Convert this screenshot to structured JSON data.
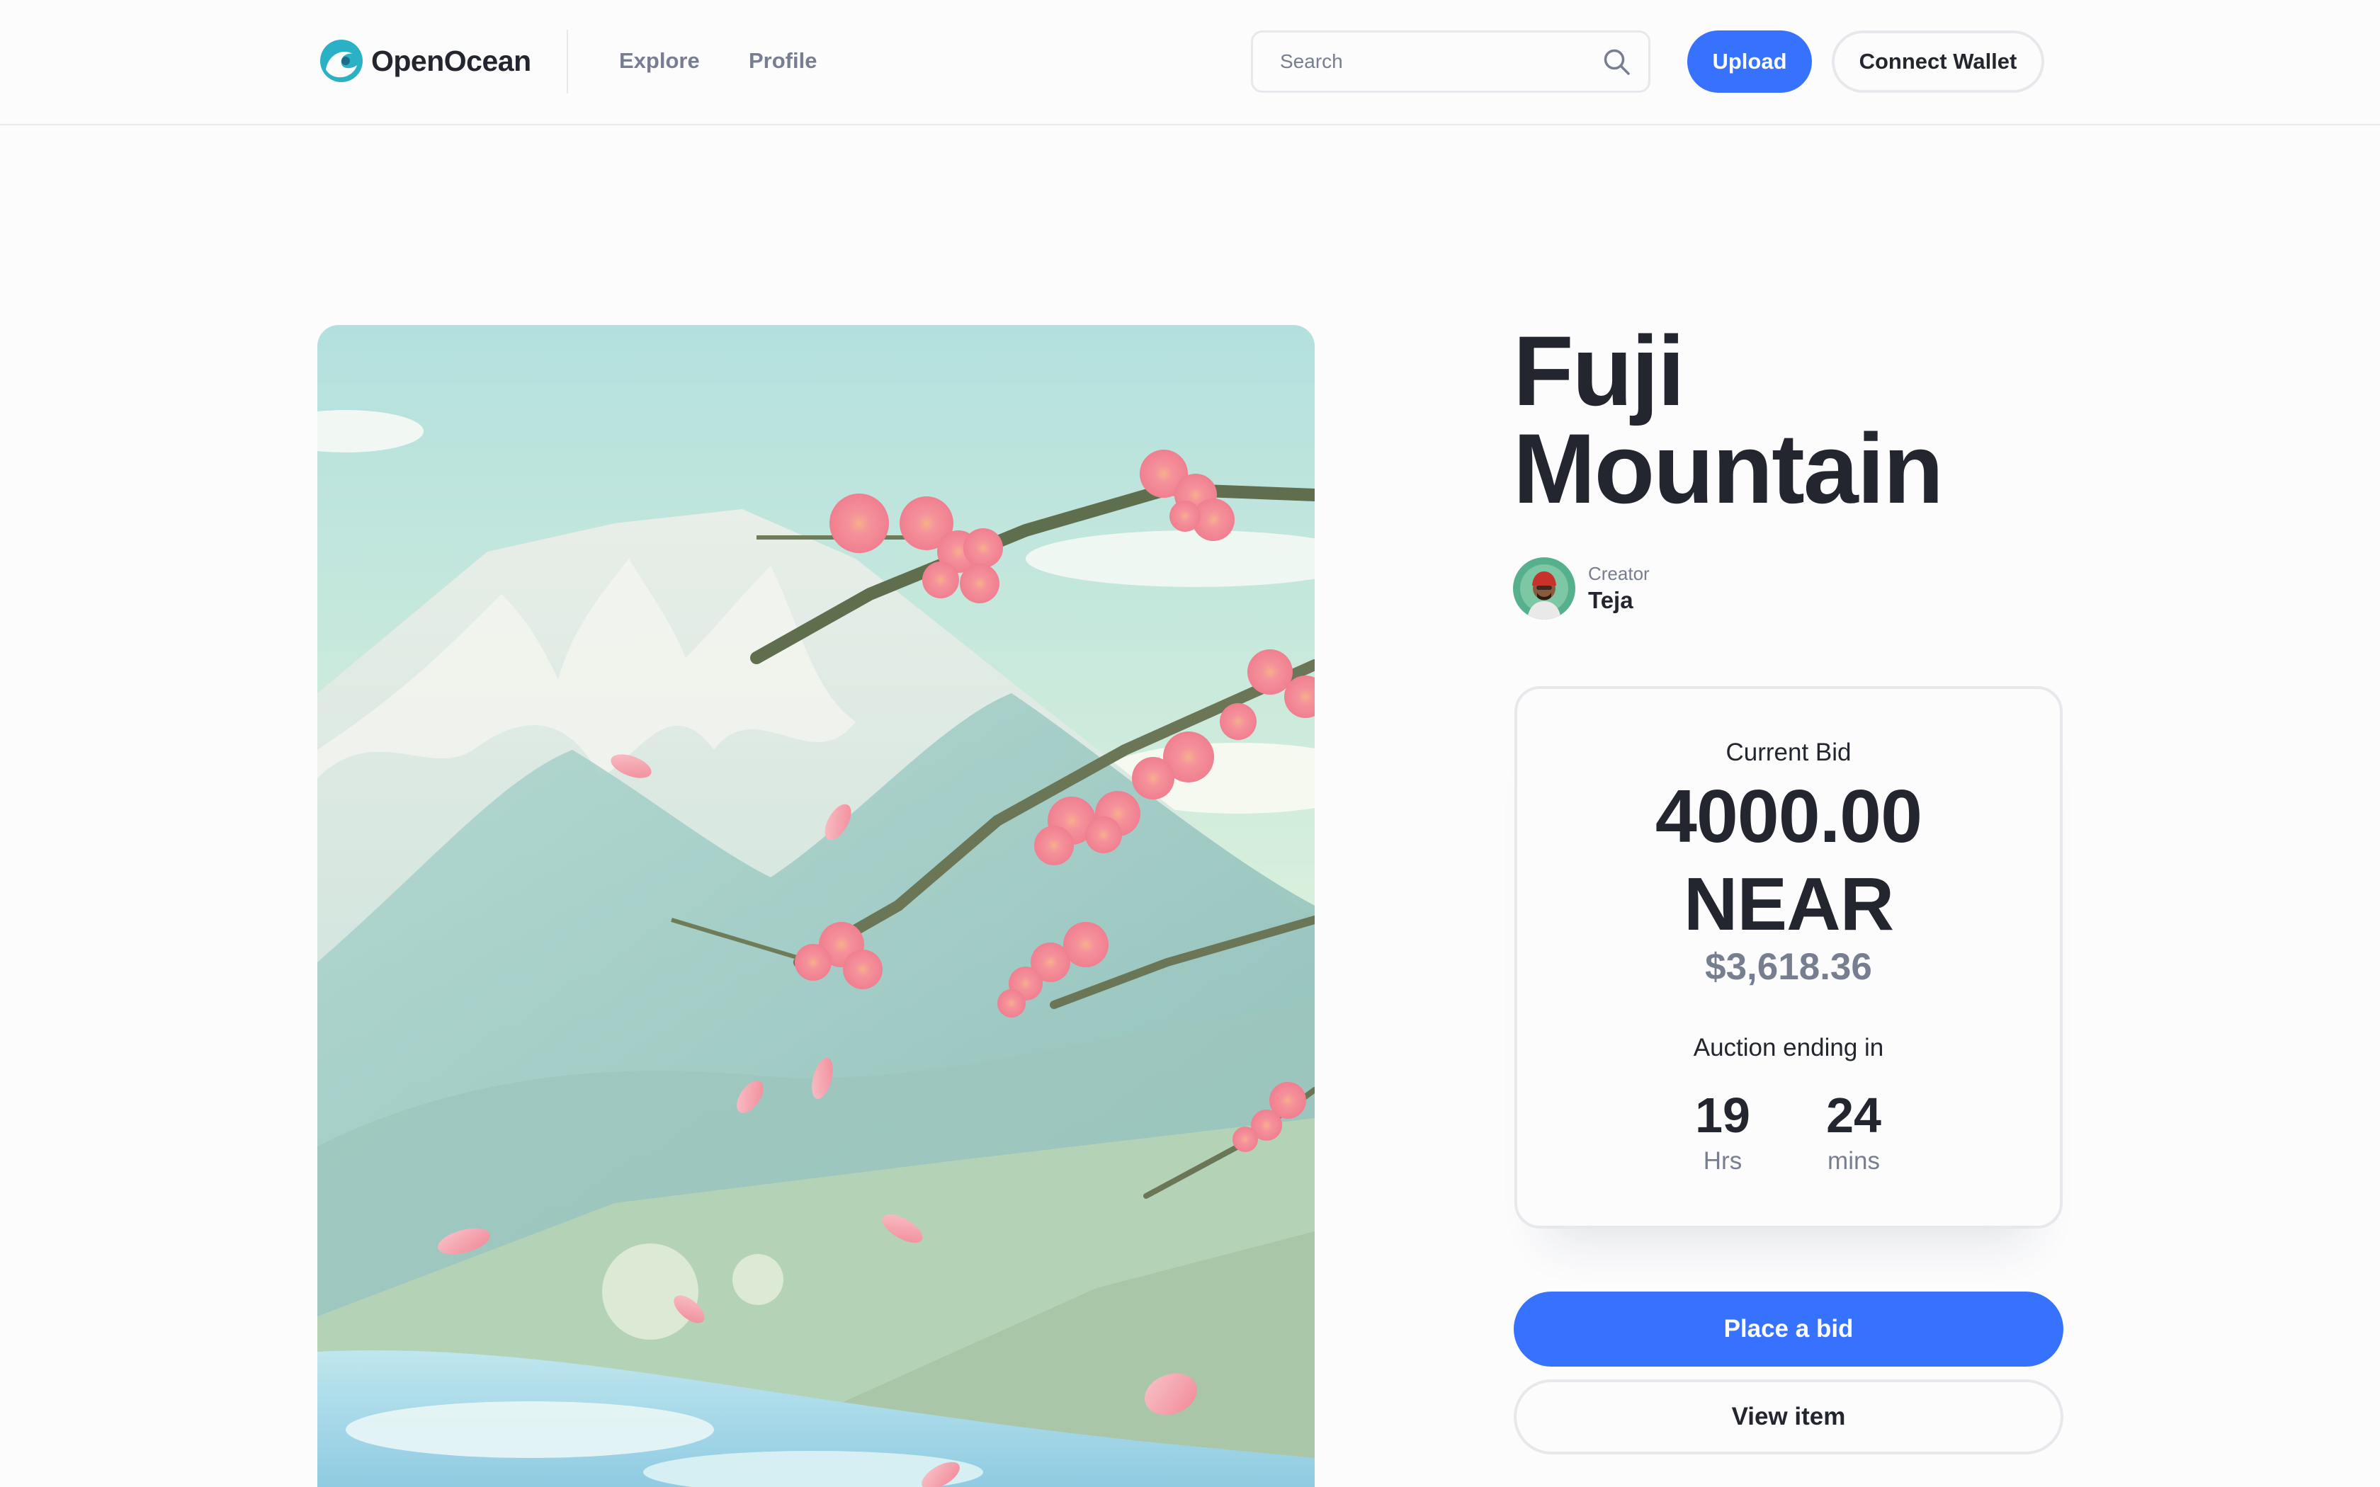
{
  "app": {
    "brand": "OpenOcean"
  },
  "nav": {
    "explore": "Explore",
    "profile": "Profile"
  },
  "search": {
    "placeholder": "Search"
  },
  "header_actions": {
    "upload": "Upload",
    "connect_wallet": "Connect Wallet"
  },
  "item": {
    "title_line1": "Fuji",
    "title_line2": "Mountain",
    "creator_label": "Creator",
    "creator_name": "Teja"
  },
  "bid": {
    "label": "Current Bid",
    "amount": "4000.00",
    "currency": "NEAR",
    "usd": "$3,618.36",
    "auction_label": "Auction ending in",
    "hours": "19",
    "hours_unit": "Hrs",
    "minutes": "24",
    "minutes_unit": "mins"
  },
  "actions": {
    "place_bid": "Place a bid",
    "view_item": "View item"
  },
  "icons": {
    "logo": "openocean-logo-icon",
    "search": "search-icon"
  },
  "colors": {
    "primary": "#3772ff",
    "text": "#23262f",
    "muted": "#777e90",
    "border": "#e6e8ec",
    "background": "#fcfcfd"
  }
}
